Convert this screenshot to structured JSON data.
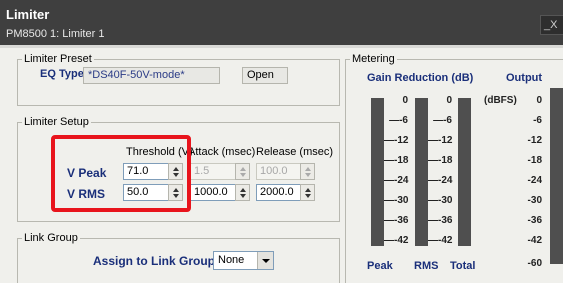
{
  "window": {
    "title": "Limiter",
    "subtitle": "PM8500 1: Limiter 1",
    "close_label": "_X"
  },
  "preset": {
    "legend": "Limiter Preset",
    "eq_label": "EQ Type:",
    "eq_value": "*DS40F-50V-mode*",
    "open_label": "Open"
  },
  "setup": {
    "legend": "Limiter Setup",
    "headers": [
      "Threshold (V)",
      "Attack (msec)",
      "Release (msec)"
    ],
    "rows": [
      {
        "label": "V Peak",
        "threshold": "71.0",
        "attack": "1.5",
        "release": "100.0"
      },
      {
        "label": "V RMS",
        "threshold": "50.0",
        "attack": "1000.0",
        "release": "2000.0"
      }
    ]
  },
  "link": {
    "legend": "Link Group",
    "assign_label": "Assign to Link Group:",
    "selected": "None"
  },
  "metering": {
    "legend": "Metering",
    "gain_reduction_title": "Gain Reduction (dB)",
    "output_title": "Output",
    "output_unit": "(dBFS)",
    "gr_ticks": [
      "0",
      "-6",
      "-12",
      "-18",
      "-24",
      "-30",
      "-36",
      "-42"
    ],
    "out_ticks": [
      "0",
      "-6",
      "-12",
      "-18",
      "-24",
      "-30",
      "-36",
      "-42",
      "-60"
    ],
    "bottom_labels": [
      "Peak",
      "RMS",
      "Total"
    ]
  },
  "colors": {
    "highlight": "#e8141c",
    "label_blue": "#1a2f7a"
  }
}
